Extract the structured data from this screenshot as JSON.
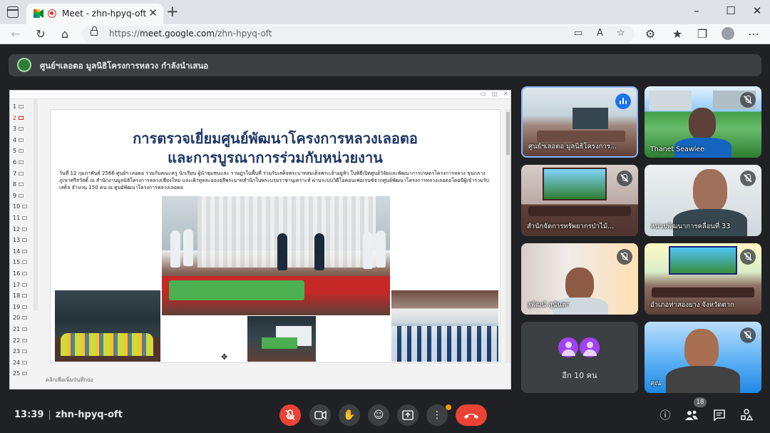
{
  "browser": {
    "tab_title": "Meet - zhn-hpyq-oft",
    "tab_close": "✕",
    "new_tab": "+",
    "url_scheme": "https://",
    "url_host": "meet.google.com",
    "url_path": "/zhn-hpyq-oft"
  },
  "banner": {
    "text": "ศูนย์ฯเลอตอ มูลนิธิโครงการหลวง กำลังนำเสนอ"
  },
  "slide": {
    "title_line1": "การตรวจเยี่ยมศูนย์พัฒนาโครงการหลวงเลอตอ",
    "title_line2": "และการบูรณาการร่วมกับหน่วยงาน",
    "body": "วันที่ 12 กุมภาพันธ์ 2566 ศูนย์ฯ เลอตอ ร่วมกับคณะครู นักเรียน ผู้นำชุมชนและ ราษฎรในพื้นที่ ร่วมรับเสด็จพระบาทสมเด็จพระเจ้าอยู่หัว ในพิธีเปิดศูนย์วิจัยและพัฒนาการเกษตรโครงการหลวง ขุนกลางภูเขาศรีสวัสดิ์ ณ สำนักงานมูลนิธิโครงการหลวงเชียงใหม่ และเฝ้าทูลละอองธุลีพระบาทสำนักในพระบรมราชานุเคราะห์ ผ่านระบบวิดีโอคอนเฟอเรนซ์จากศูนย์พัฒนาโครงการหลวงเลอตอโดยมีผู้เข้าร่วมรับเสด็จ จำนวน 150 คน ณ ศูนย์พัฒนาโครงการหลวงเลอตอ",
    "notes": "คลิกเพื่อเพิ่มบันทึกย่อ",
    "thumb_numbers": [
      "1",
      "2",
      "3",
      "4",
      "5",
      "6",
      "7",
      "8",
      "9",
      "10",
      "11",
      "12",
      "13",
      "14",
      "15",
      "16",
      "17",
      "18",
      "19",
      "20",
      "21",
      "22",
      "23",
      "24",
      "25"
    ],
    "active_slide": 2
  },
  "participants": [
    {
      "name": "ศูนย์ฯเลอตอ มูลนิธิโครงการ...",
      "status": "speaking"
    },
    {
      "name": "Thanet Seawlee",
      "status": "muted"
    },
    {
      "name": "สำนักจัดการทรัพยากรป่าไม้...",
      "status": "muted"
    },
    {
      "name": "หน่วยพัฒนาการคลื่อนที่ 33",
      "status": "muted"
    },
    {
      "name": "สุพัฒน์ สุนันตา",
      "status": "muted"
    },
    {
      "name": "อำเภอท่าสองยาง จังหวัดตาก",
      "status": "muted"
    },
    {
      "name": "คุณ",
      "status": "muted"
    }
  ],
  "others": {
    "label": "อีก 10 คน"
  },
  "bottom": {
    "time": "13:39",
    "meeting_code": "zhn-hpyq-oft",
    "participant_count": "18"
  },
  "icons": {
    "mic_off": "mic-off-icon",
    "camera": "camera-icon",
    "hand": "raise-hand-icon",
    "emoji": "emoji-icon",
    "present": "present-icon",
    "more": "more-options-icon",
    "end_call": "end-call-icon",
    "info": "info-icon",
    "people": "people-icon",
    "chat": "chat-icon",
    "activities": "activities-icon"
  },
  "colors": {
    "meet_bg": "#202124",
    "end_call": "#ea4335",
    "active_border": "#8ab4f8",
    "slide_title": "#1f3864"
  }
}
